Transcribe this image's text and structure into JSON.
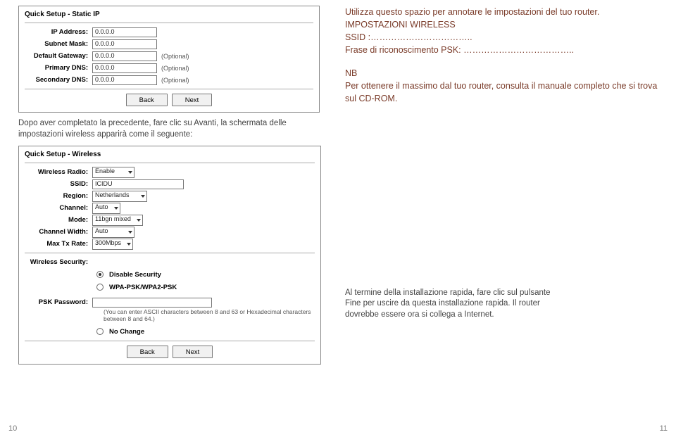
{
  "left": {
    "static_ip": {
      "title": "Quick Setup - Static IP",
      "rows": {
        "ip_label": "IP Address:",
        "ip_value": "0.0.0.0",
        "mask_label": "Subnet Mask:",
        "mask_value": "0.0.0.0",
        "gw_label": "Default Gateway:",
        "gw_value": "0.0.0.0",
        "gw_opt": "(Optional)",
        "dns1_label": "Primary DNS:",
        "dns1_value": "0.0.0.0",
        "dns1_opt": "(Optional)",
        "dns2_label": "Secondary DNS:",
        "dns2_value": "0.0.0.0",
        "dns2_opt": "(Optional)"
      },
      "back": "Back",
      "next": "Next"
    },
    "para_after_static": "Dopo aver completato la precedente, fare clic su Avanti, la schermata delle impostazioni wireless apparirà come il seguente:",
    "wireless": {
      "title": "Quick Setup - Wireless",
      "rows": {
        "radio_label": "Wireless Radio:",
        "radio_value": "Enable",
        "ssid_label": "SSID:",
        "ssid_value": "ICIDU",
        "region_label": "Region:",
        "region_value": "Netherlands",
        "channel_label": "Channel:",
        "channel_value": "Auto",
        "mode_label": "Mode:",
        "mode_value": "11bgn mixed",
        "chw_label": "Channel Width:",
        "chw_value": "Auto",
        "tx_label": "Max Tx Rate:",
        "tx_value": "300Mbps"
      },
      "sec_label": "Wireless Security:",
      "sec_opts": {
        "disable": "Disable Security",
        "wpa": "WPA-PSK/WPA2-PSK",
        "nochange": "No Change"
      },
      "psk_label": "PSK Password:",
      "psk_hint": "(You can enter ASCII characters between 8 and 63 or Hexadecimal characters between 8 and 64.)",
      "back": "Back",
      "next": "Next"
    },
    "pagenum": "10"
  },
  "right": {
    "intro": "Utilizza questo spazio per annotare le impostazioni del tuo router.",
    "wireless_heading": "IMPOSTAZIONI WIRELESS",
    "ssid_line": "SSID            :……………………………..",
    "psk_line": "Frase di riconoscimento PSK: ………………………………..",
    "nb_title": "NB",
    "nb_body": "Per ottenere il massimo dal tuo router, consulta il manuale completo che si trova sul CD-ROM.",
    "closing": "Al termine della installazione rapida, fare clic sul pulsante Fine per uscire da questa installazione rapida. Il router dovrebbe essere ora si collega a Internet.",
    "pagenum": "11"
  }
}
